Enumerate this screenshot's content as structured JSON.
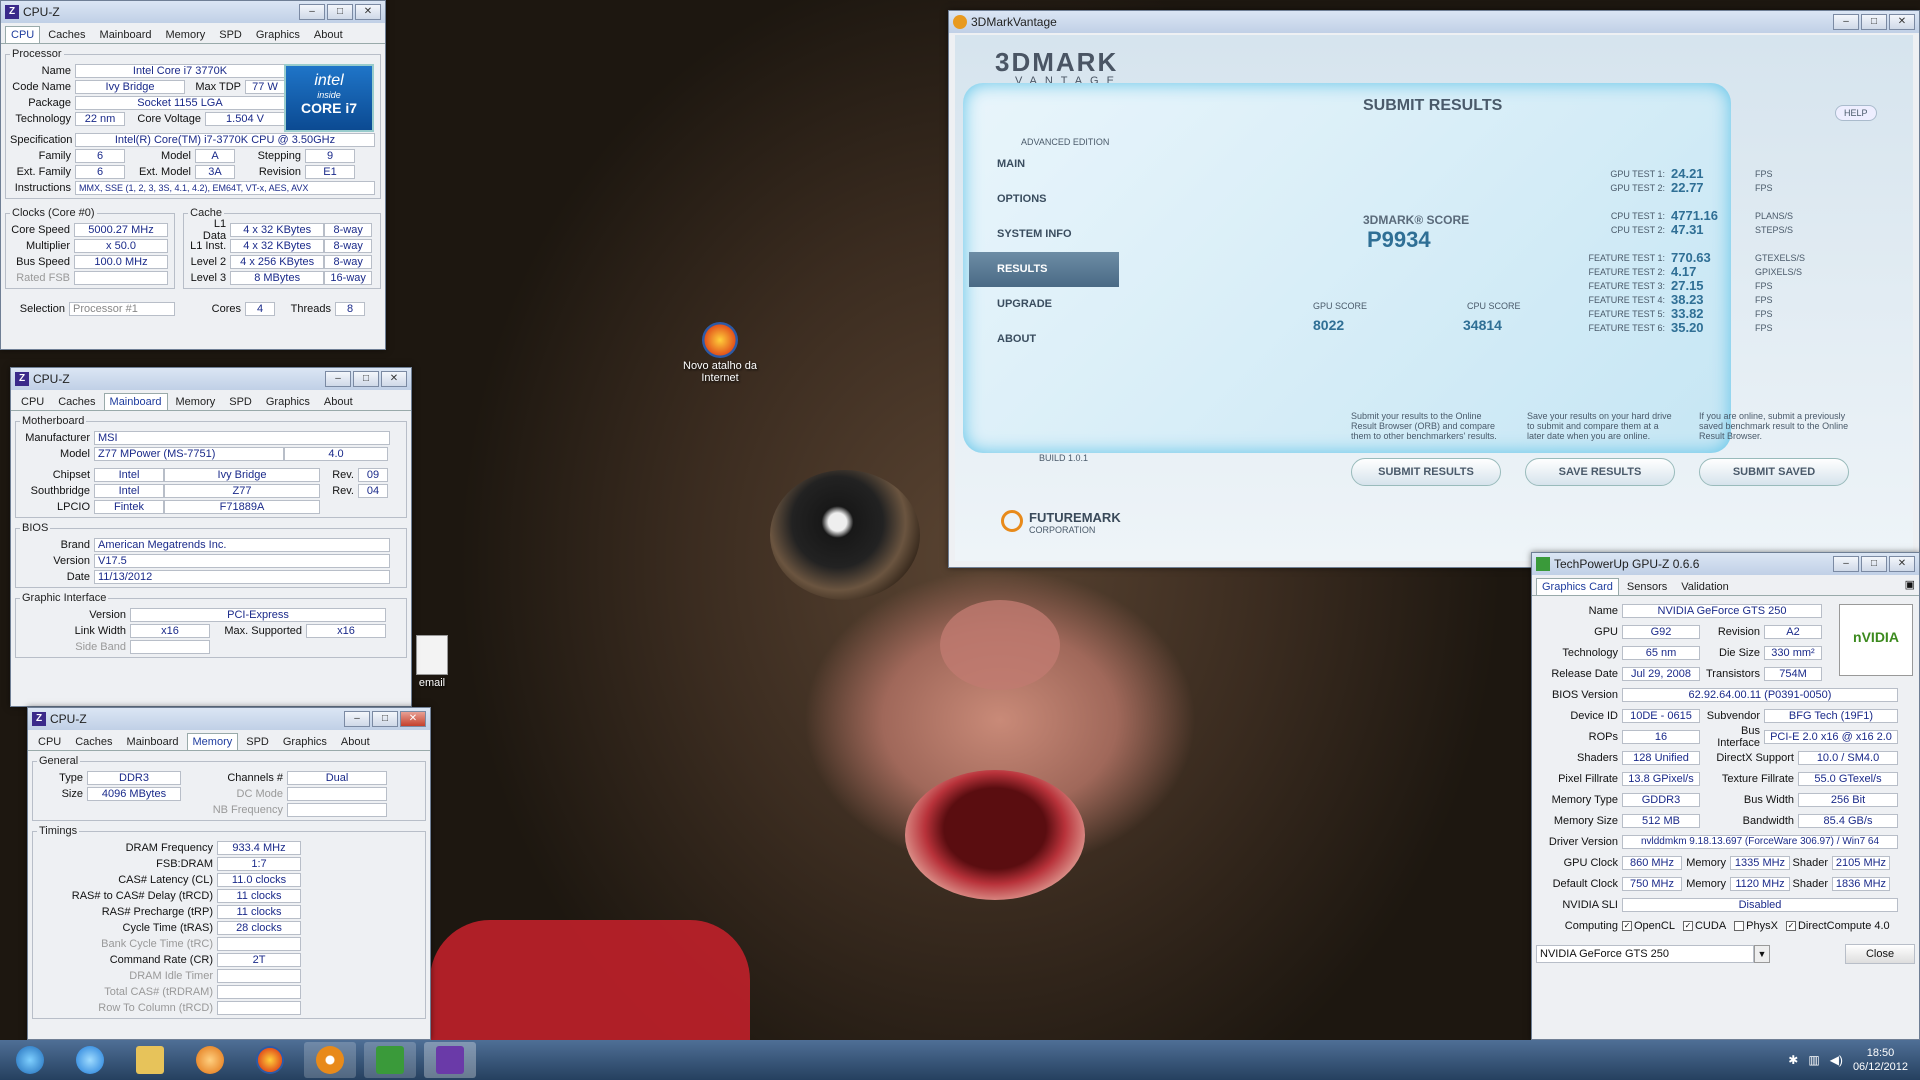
{
  "desktop": {
    "icon1": "Novo atalho da Internet",
    "icon2": "email"
  },
  "cpuz1": {
    "title": "CPU-Z",
    "tabs": [
      "CPU",
      "Caches",
      "Mainboard",
      "Memory",
      "SPD",
      "Graphics",
      "About"
    ],
    "processor": {
      "legend": "Processor",
      "name_l": "Name",
      "name": "Intel Core i7 3770K",
      "codename_l": "Code Name",
      "codename": "Ivy Bridge",
      "maxtdp_l": "Max TDP",
      "maxtdp": "77 W",
      "package_l": "Package",
      "package": "Socket 1155 LGA",
      "tech_l": "Technology",
      "tech": "22 nm",
      "volt_l": "Core Voltage",
      "volt": "1.504 V",
      "spec_l": "Specification",
      "spec": "Intel(R) Core(TM) i7-3770K CPU @ 3.50GHz",
      "family_l": "Family",
      "family": "6",
      "model_l": "Model",
      "model": "A",
      "stepping_l": "Stepping",
      "stepping": "9",
      "extfam_l": "Ext. Family",
      "extfam": "6",
      "extmod_l": "Ext. Model",
      "extmod": "3A",
      "rev_l": "Revision",
      "rev": "E1",
      "instr_l": "Instructions",
      "instr": "MMX, SSE (1, 2, 3, 3S, 4.1, 4.2), EM64T, VT-x, AES, AVX",
      "logo1": "intel",
      "logo2": "inside",
      "logo3": "CORE i7"
    },
    "clocks": {
      "legend": "Clocks (Core #0)",
      "speed_l": "Core Speed",
      "speed": "5000.27 MHz",
      "mult_l": "Multiplier",
      "mult": "x 50.0",
      "bus_l": "Bus Speed",
      "bus": "100.0 MHz",
      "fsb_l": "Rated FSB"
    },
    "cache": {
      "legend": "Cache",
      "l1d_l": "L1 Data",
      "l1d": "4 x 32 KBytes",
      "l1d_w": "8-way",
      "l1i_l": "L1 Inst.",
      "l1i": "4 x 32 KBytes",
      "l1i_w": "8-way",
      "l2_l": "Level 2",
      "l2": "4 x 256 KBytes",
      "l2_w": "8-way",
      "l3_l": "Level 3",
      "l3": "8 MBytes",
      "l3_w": "16-way"
    },
    "sel_l": "Selection",
    "sel": "Processor #1",
    "cores_l": "Cores",
    "cores": "4",
    "threads_l": "Threads",
    "threads": "8"
  },
  "cpuz2": {
    "title": "CPU-Z",
    "mb_legend": "Motherboard",
    "manu_l": "Manufacturer",
    "manu": "MSI",
    "model_l": "Model",
    "model": "Z77 MPower (MS-7751)",
    "model_rev": "4.0",
    "chip_l": "Chipset",
    "chip1": "Intel",
    "chip2": "Ivy Bridge",
    "rev_l": "Rev.",
    "chip_rev": "09",
    "sb_l": "Southbridge",
    "sb1": "Intel",
    "sb2": "Z77",
    "sb_rev": "04",
    "lpc_l": "LPCIO",
    "lpc1": "Fintek",
    "lpc2": "F71889A",
    "bios_legend": "BIOS",
    "brand_l": "Brand",
    "brand": "American Megatrends Inc.",
    "ver_l": "Version",
    "ver": "V17.5",
    "date_l": "Date",
    "date": "11/13/2012",
    "gi_legend": "Graphic Interface",
    "giver_l": "Version",
    "giver": "PCI-Express",
    "lw_l": "Link Width",
    "lw": "x16",
    "ms_l": "Max. Supported",
    "ms": "x16",
    "sb2_l": "Side Band"
  },
  "cpuz3": {
    "title": "CPU-Z",
    "gen_legend": "General",
    "type_l": "Type",
    "type": "DDR3",
    "ch_l": "Channels #",
    "ch": "Dual",
    "size_l": "Size",
    "size": "4096 MBytes",
    "dc_l": "DC Mode",
    "nb_l": "NB Frequency",
    "tim_legend": "Timings",
    "dram_l": "DRAM Frequency",
    "dram": "933.4 MHz",
    "fsb_l": "FSB:DRAM",
    "fsb": "1:7",
    "cas_l": "CAS# Latency (CL)",
    "cas": "11.0 clocks",
    "rcd_l": "RAS# to CAS# Delay (tRCD)",
    "rcd": "11 clocks",
    "rp_l": "RAS# Precharge (tRP)",
    "rp": "11 clocks",
    "ras_l": "Cycle Time (tRAS)",
    "ras": "28 clocks",
    "rc_l": "Bank Cycle Time (tRC)",
    "cr_l": "Command Rate (CR)",
    "cr": "2T",
    "idle_l": "DRAM Idle Timer",
    "trdram_l": "Total CAS# (tRDRAM)",
    "rtc_l": "Row To Column (tRCD)"
  },
  "mark": {
    "title": "3DMarkVantage",
    "logo": "3DMARK",
    "logo2": "VANTAGE",
    "edition": "ADVANCED EDITION",
    "nav": [
      "MAIN",
      "OPTIONS",
      "SYSTEM INFO",
      "RESULTS",
      "UPGRADE",
      "ABOUT"
    ],
    "build": "BUILD 1.0.1",
    "help": "HELP",
    "header": "SUBMIT RESULTS",
    "score_l": "3DMARK® SCORE",
    "score": "P9934",
    "gpu_l": "GPU SCORE",
    "gpu": "8022",
    "cpu_l": "CPU SCORE",
    "cpu": "34814",
    "tests": [
      [
        "GPU TEST 1:",
        "24.21",
        "FPS"
      ],
      [
        "GPU TEST 2:",
        "22.77",
        "FPS"
      ],
      [
        "CPU TEST 1:",
        "4771.16",
        "PLANS/S"
      ],
      [
        "CPU TEST 2:",
        "47.31",
        "STEPS/S"
      ],
      [
        "FEATURE TEST 1:",
        "770.63",
        "GTEXELS/S"
      ],
      [
        "FEATURE TEST 2:",
        "4.17",
        "GPIXELS/S"
      ],
      [
        "FEATURE TEST 3:",
        "27.15",
        "FPS"
      ],
      [
        "FEATURE TEST 4:",
        "38.23",
        "FPS"
      ],
      [
        "FEATURE TEST 5:",
        "33.82",
        "FPS"
      ],
      [
        "FEATURE TEST 6:",
        "35.20",
        "FPS"
      ]
    ],
    "d1": "Submit your results to the Online Result Browser (ORB) and compare them to other benchmarkers' results.",
    "d2": "Save your results on your hard drive to submit and compare them at a later date when you are online.",
    "d3": "If you are online, submit a previously saved benchmark result to the Online Result Browser.",
    "b1": "SUBMIT RESULTS",
    "b2": "SAVE RESULTS",
    "b3": "SUBMIT SAVED",
    "fm": "FUTUREMARK",
    "fm2": "CORPORATION"
  },
  "gpuz": {
    "title": "TechPowerUp GPU-Z 0.6.6",
    "tabs": [
      "Graphics Card",
      "Sensors",
      "Validation"
    ],
    "logo": "nVIDIA",
    "name_l": "Name",
    "name": "NVIDIA GeForce GTS 250",
    "gpu_l": "GPU",
    "gpu": "G92",
    "rev_l": "Revision",
    "rev": "A2",
    "tech_l": "Technology",
    "tech": "65 nm",
    "die_l": "Die Size",
    "die": "330 mm²",
    "rel_l": "Release Date",
    "rel": "Jul 29, 2008",
    "tr_l": "Transistors",
    "tr": "754M",
    "bios_l": "BIOS Version",
    "bios": "62.92.64.00.11 (P0391-0050)",
    "dev_l": "Device ID",
    "dev": "10DE - 0615",
    "sub_l": "Subvendor",
    "sub": "BFG Tech (19F1)",
    "rops_l": "ROPs",
    "rops": "16",
    "bus_l": "Bus Interface",
    "bus": "PCI-E 2.0 x16 @ x16 2.0",
    "sh_l": "Shaders",
    "sh": "128 Unified",
    "dx_l": "DirectX Support",
    "dx": "10.0 / SM4.0",
    "pf_l": "Pixel Fillrate",
    "pf": "13.8 GPixel/s",
    "tf_l": "Texture Fillrate",
    "tf": "55.0 GTexel/s",
    "mt_l": "Memory Type",
    "mt": "GDDR3",
    "bw_l": "Bus Width",
    "bw": "256 Bit",
    "ms_l": "Memory Size",
    "ms": "512 MB",
    "band_l": "Bandwidth",
    "band": "85.4 GB/s",
    "drv_l": "Driver Version",
    "drv": "nvlddmkm 9.18.13.697 (ForceWare 306.97) / Win7 64",
    "gc_l": "GPU Clock",
    "gc": "860 MHz",
    "mem_l": "Memory",
    "mem": "1335 MHz",
    "shd_l": "Shader",
    "shd": "2105 MHz",
    "dc_l": "Default Clock",
    "dc": "750 MHz",
    "dmem": "1120 MHz",
    "dshd": "1836 MHz",
    "sli_l": "NVIDIA SLI",
    "sli": "Disabled",
    "comp_l": "Computing",
    "c1": "OpenCL",
    "c2": "CUDA",
    "c3": "PhysX",
    "c4": "DirectCompute 4.0",
    "sel": "NVIDIA GeForce GTS 250",
    "close": "Close"
  },
  "taskbar": {
    "time": "18:50",
    "date": "06/12/2012"
  }
}
